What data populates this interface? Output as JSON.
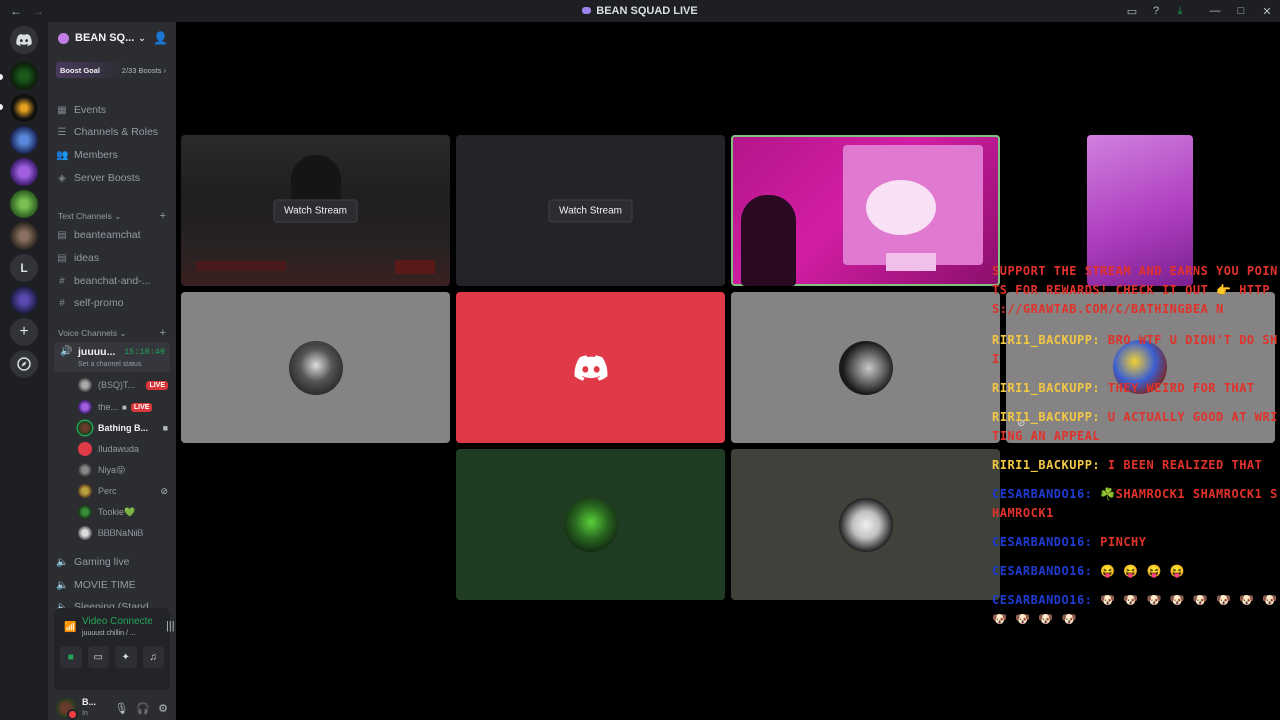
{
  "window": {
    "title": "BEAN SQUAD LIVE",
    "back": "←",
    "forward": "→",
    "controls": [
      "▭",
      "?",
      "⤓",
      "—",
      "□",
      "✕"
    ]
  },
  "rail": {
    "servers": [
      "home-discord",
      "green-star",
      "crescent",
      "gamer-squad",
      "bsq",
      "green-pack",
      "photo",
      "L",
      "purple-orb",
      "add-server",
      "discover"
    ],
    "letter": "L",
    "plus": "+"
  },
  "sidebar": {
    "server_name": "BEAN SQ...",
    "boost_label": "Boost Goal",
    "boost_count": "2/33 Boosts ›",
    "menu": [
      "Events",
      "Channels & Roles",
      "Members",
      "Server Boosts"
    ],
    "text_category": "Text Channels ⌄",
    "text_channels": [
      "beanteamchat",
      "ideas",
      "beanchat-and-...",
      "self-promo"
    ],
    "voice_category": "Voice Channels ⌄",
    "active_voice": {
      "name": "juuuu...",
      "time": "15:18:49",
      "status": "Set a channel status"
    },
    "members": [
      {
        "name": "(BSQ)T...",
        "badge": "LIVE"
      },
      {
        "name": "the...",
        "badge": "LIVE"
      },
      {
        "name": "Bathing B..."
      },
      {
        "name": "Iludawuda"
      },
      {
        "name": "Niya😝"
      },
      {
        "name": "Perc"
      },
      {
        "name": "Tookie💚"
      },
      {
        "name": "ᏴᏴᏴNaNᎥᎥᏴ"
      }
    ],
    "other_voice": [
      "Gaming live",
      "MOVIE TIME",
      "Sleeping (Stand..."
    ],
    "voice_connected": {
      "title": "Video Connected",
      "subtitle": "juuuust chillin / ..."
    },
    "user": {
      "name": "B...",
      "status": "In"
    }
  },
  "tiles": {
    "watch_stream": "Watch Stream"
  },
  "chat": [
    {
      "user": "",
      "text": "SUPPORT THE STREAM AND EARNS YOU POINTS FOR REWARDS! CHECK IT OUT 👉 HTTPS://GRAWTAB.COM/C/BATHINGBEA N"
    },
    {
      "user": "RIRI1_BACKUPP:",
      "text": "BRO WTF U DIDN'T DO SHI"
    },
    {
      "user": "RIRI1_BACKUPP:",
      "text": "THEY WEIRD FOR THAT"
    },
    {
      "user": "RIRI1_BACKUPP:",
      "text": "U ACTUALLY GOOD AT WRITING AN APPEAL"
    },
    {
      "user": "RIRI1_BACKUPP:",
      "text": "I BEEN REALIZED THAT"
    },
    {
      "user": "CESARBANDO16:",
      "text": "☘️SHAMROCK1 SHAMROCK1 SHAMROCK1"
    },
    {
      "user": "CESARBANDO16:",
      "text": "PINCHY"
    },
    {
      "user": "CESARBANDO16:",
      "text": "😝 😝 😝 😝"
    },
    {
      "user": "CESARBANDO16:",
      "text": "🐶 🐶 🐶 🐶 🐶 🐶 🐶 🐶 🐶 🐶 🐶 🐶"
    }
  ],
  "colors": {
    "accent_green": "#23a55a",
    "live_red": "#da373c",
    "discord_red": "#e03a48",
    "chat_user_yellow": "#f2c744",
    "chat_user_blue": "#1f3ccf",
    "chat_message_red": "#e0322b"
  }
}
